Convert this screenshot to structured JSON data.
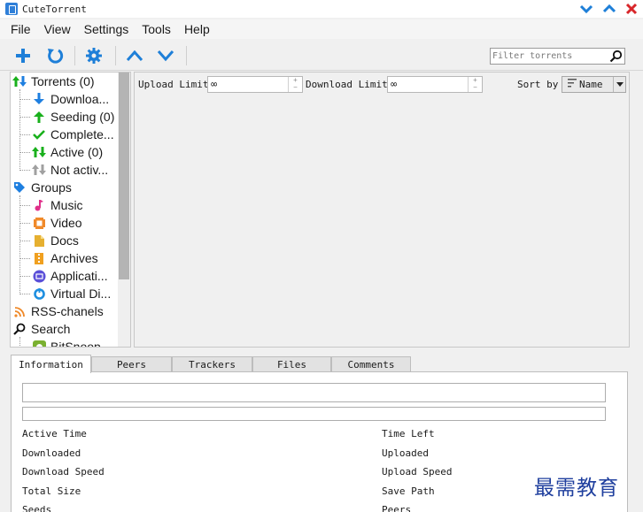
{
  "window": {
    "title": "CuteTorrent"
  },
  "menu": [
    "File",
    "View",
    "Settings",
    "Tools",
    "Help"
  ],
  "toolbar": {
    "filter_placeholder": "Filter torrents",
    "icons": [
      "add-icon",
      "refresh-icon",
      "settings-icon",
      "move-up-icon",
      "move-down-icon"
    ]
  },
  "sidebar": {
    "torrents": {
      "label": "Torrents (0)",
      "items": [
        {
          "label": "Downloa...",
          "icon": "download-arrow-icon",
          "color": "#1e7fe0"
        },
        {
          "label": "Seeding (0)",
          "icon": "upload-arrow-icon",
          "color": "#19b01c"
        },
        {
          "label": "Complete...",
          "icon": "check-icon",
          "color": "#19b01c"
        },
        {
          "label": "Active (0)",
          "icon": "active-arrows-icon",
          "color": "#19b01c"
        },
        {
          "label": "Not activ...",
          "icon": "inactive-arrows-icon",
          "color": "#9a9a9a"
        }
      ]
    },
    "groups": {
      "label": "Groups",
      "items": [
        {
          "label": "Music",
          "icon": "music-icon",
          "color": "#e0308a"
        },
        {
          "label": "Video",
          "icon": "video-icon",
          "color": "#f08a2a"
        },
        {
          "label": "Docs",
          "icon": "docs-icon",
          "color": "#e6b030"
        },
        {
          "label": "Archives",
          "icon": "archive-icon",
          "color": "#f0a020"
        },
        {
          "label": "Applicati...",
          "icon": "application-icon",
          "color": "#5a4fd8"
        },
        {
          "label": "Virtual Di...",
          "icon": "disc-icon",
          "color": "#1e8fe0"
        }
      ]
    },
    "rss": {
      "label": "RSS-chanels"
    },
    "search": {
      "label": "Search",
      "items": [
        {
          "label": "BitSnoop",
          "icon": "bitsnoop-icon",
          "color": "#7ab030"
        }
      ]
    }
  },
  "limits": {
    "upload_label": "Upload Limit",
    "upload_value": "∞",
    "download_label": "Download Limit",
    "download_value": "∞",
    "sort_label": "Sort by",
    "sort_value": "Name"
  },
  "tabs": [
    "Information",
    "Peers",
    "Trackers",
    "Files",
    "Comments"
  ],
  "info": {
    "left": [
      "Active Time",
      "Downloaded",
      "Download Speed",
      "Total Size",
      "Seeds"
    ],
    "right": [
      "Time Left",
      "Uploaded",
      "Upload Speed",
      "Save Path",
      "Peers"
    ]
  },
  "watermark": "最需教育"
}
